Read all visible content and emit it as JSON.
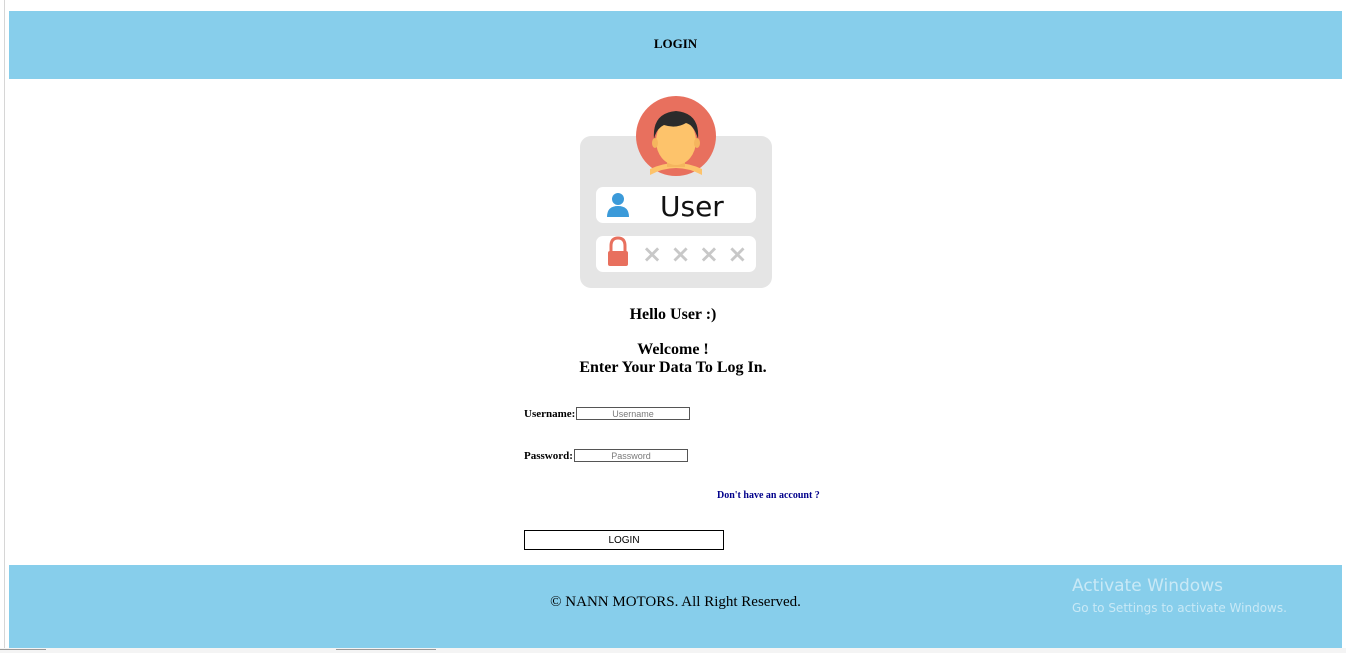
{
  "header": {
    "title": "LOGIN"
  },
  "illustration": {
    "user_text": "User",
    "password_mask": "× × × ×",
    "colors": {
      "card": "#e5e5e5",
      "avatar_circle": "#e8705e",
      "face": "#fdc36b",
      "hair": "#2b2b2b",
      "user_icon": "#3b9ad9",
      "lock_icon": "#e8705e",
      "mask": "#c8c8c8"
    }
  },
  "greeting": "Hello User :)",
  "welcome": {
    "line1": "Welcome !",
    "line2": "Enter Your Data To Log In."
  },
  "form": {
    "username_label": "Username:",
    "username_placeholder": "Username",
    "username_value": "",
    "password_label": "Password:",
    "password_placeholder": "Password",
    "password_value": "",
    "signup_link": "Don't have an account ?",
    "submit_label": "LOGIN"
  },
  "footer": {
    "copyright": "© NANN MOTORS. All Right Reserved."
  },
  "watermark": {
    "title": "Activate Windows",
    "subtitle": "Go to Settings to activate Windows."
  },
  "colors": {
    "bar_background": "#87ceeb",
    "link": "#00008b"
  }
}
